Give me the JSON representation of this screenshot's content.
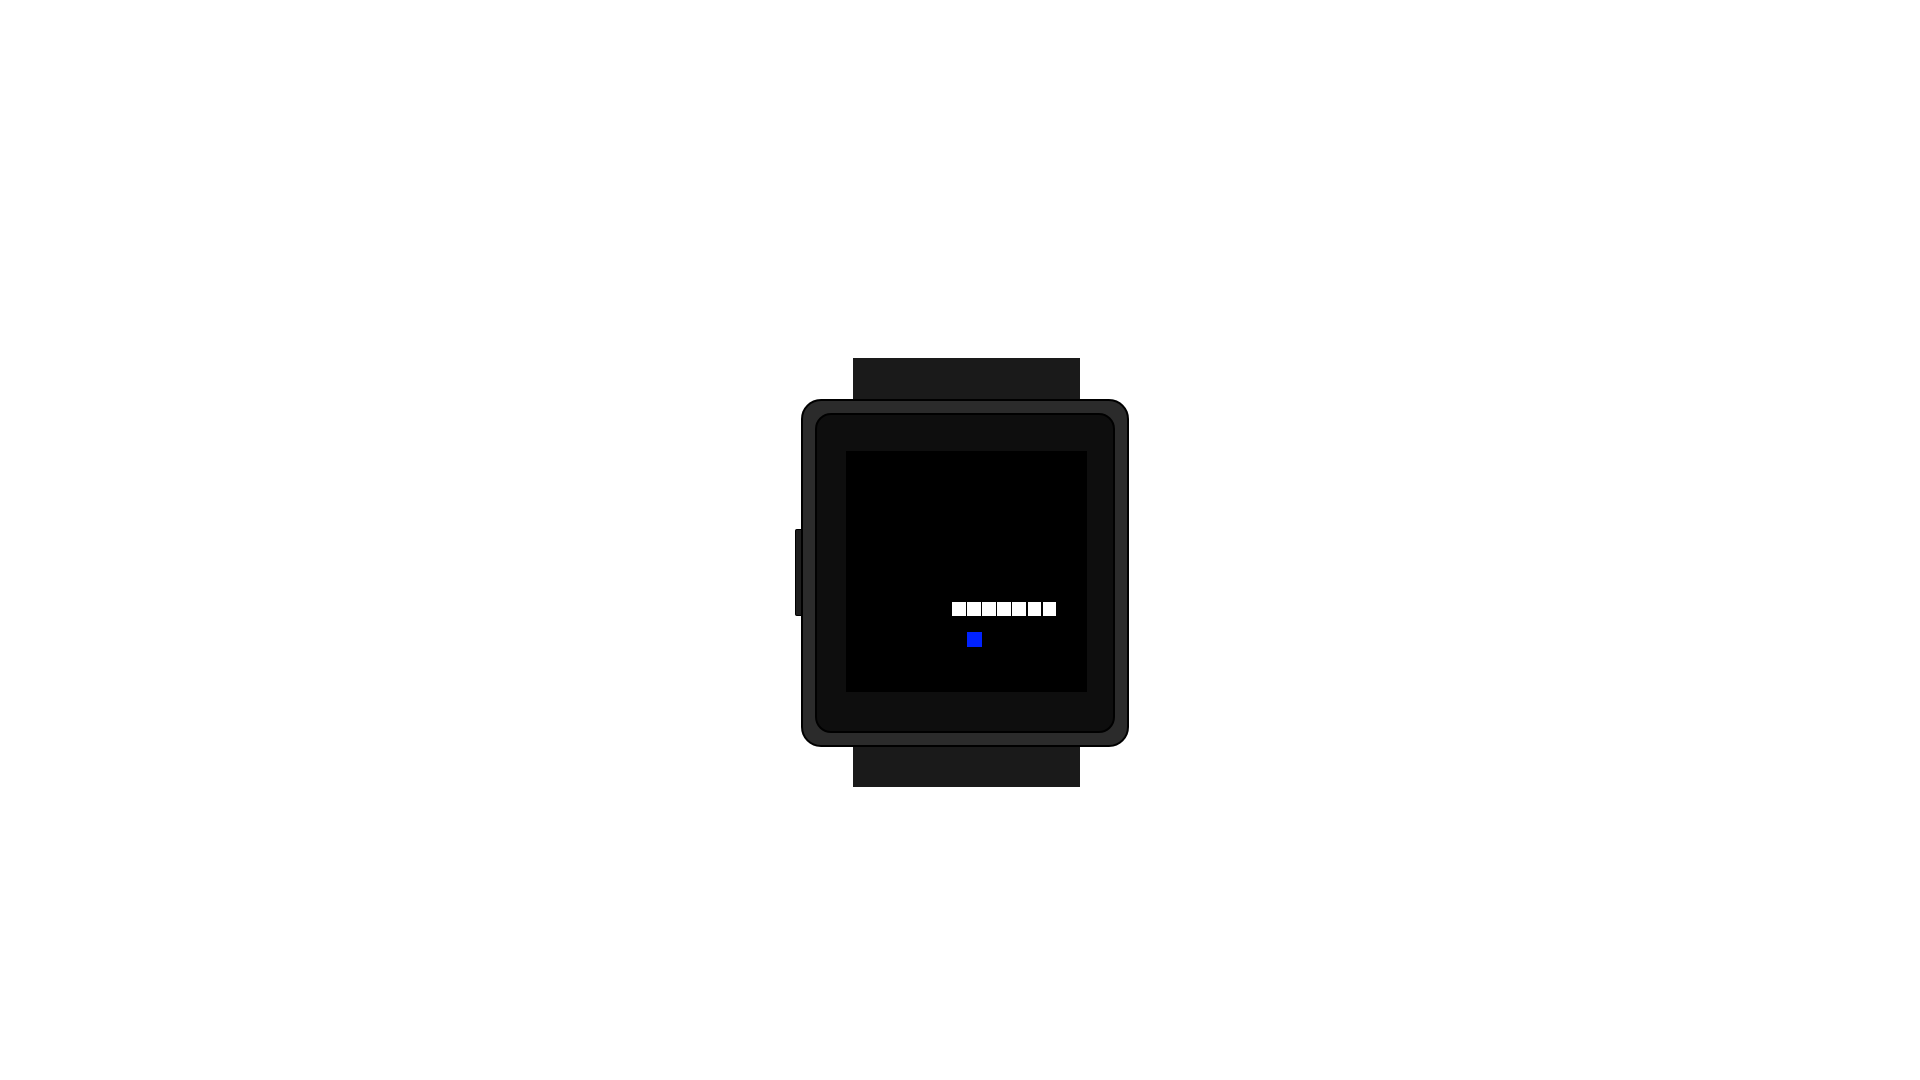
{
  "game": {
    "grid": {
      "cols": 16,
      "rows": 16
    },
    "snake": {
      "color": "#ffffff",
      "segments": [
        {
          "col": 7,
          "row": 10
        },
        {
          "col": 8,
          "row": 10
        },
        {
          "col": 9,
          "row": 10
        },
        {
          "col": 10,
          "row": 10
        },
        {
          "col": 11,
          "row": 10
        },
        {
          "col": 12,
          "row": 10
        },
        {
          "col": 13,
          "row": 10
        }
      ]
    },
    "food": {
      "color": "#0022ff",
      "col": 8,
      "row": 12
    }
  },
  "device": {
    "case_color": "#2b2b2b",
    "bezel_color": "#0e0e0e",
    "strap_color": "#1a1a1a",
    "screen_color": "#000000"
  }
}
